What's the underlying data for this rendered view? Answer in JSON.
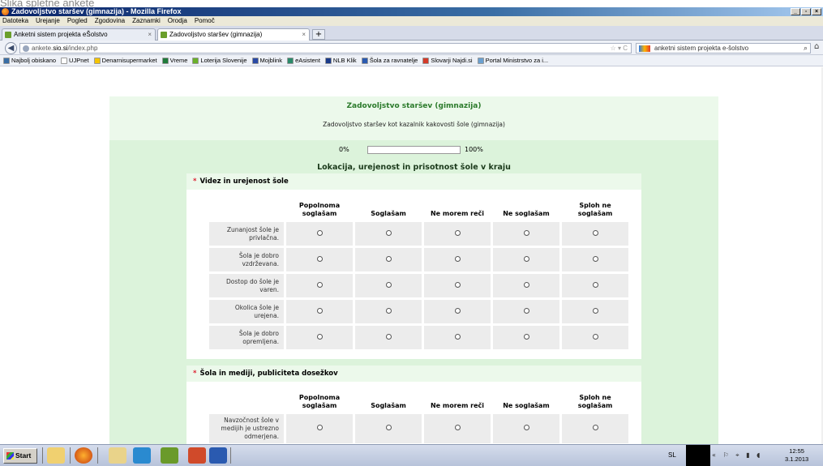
{
  "caption": "Slika spletne ankete",
  "window": {
    "title": "Zadovoljstvo staršev (gimnazija) - Mozilla Firefox",
    "controls": [
      "_",
      "▫",
      "×"
    ]
  },
  "menu": [
    "Datoteka",
    "Urejanje",
    "Pogled",
    "Zgodovina",
    "Zaznamki",
    "Orodja",
    "Pomoč"
  ],
  "tabs": [
    {
      "label": "Anketni sistem projekta eŠolstvo",
      "close": "×"
    },
    {
      "label": "Zadovoljstvo staršev (gimnazija)",
      "close": "×"
    }
  ],
  "newtab": "+",
  "nav": {
    "back": "◀",
    "url_prefix": "ankete.",
    "url_domain": "sio.si",
    "url_suffix": "/index.php",
    "url_icons": "☆ ▾ C",
    "search_text": "anketni sistem projekta e-šolstvo",
    "search_glyph": "⌕",
    "home": "⌂"
  },
  "bookmarks": [
    {
      "label": "Najbolj obiskano",
      "color": "#3a6ea5"
    },
    {
      "label": "UJPnet",
      "color": "#ffffff"
    },
    {
      "label": "Denarnisupermarket",
      "color": "#f5c400"
    },
    {
      "label": "Vreme",
      "color": "#1f7a3a"
    },
    {
      "label": "Loterija Slovenije",
      "color": "#6ab02a"
    },
    {
      "label": "Mojblink",
      "color": "#2a4aa5"
    },
    {
      "label": "eAsistent",
      "color": "#2a8a6a"
    },
    {
      "label": "NLB Klik",
      "color": "#1a3a8a"
    },
    {
      "label": "Šola za ravnatelje",
      "color": "#2a5ab0"
    },
    {
      "label": "Slovarji Najdi.si",
      "color": "#d33a2a"
    },
    {
      "label": "Portal Ministrstvo za i...",
      "color": "#6aa0d0"
    }
  ],
  "survey": {
    "title": "Zadovoljstvo staršev (gimnazija)",
    "subtitle": "Zadovoljstvo staršev kot kazalnik kakovosti šole (gimnazija)",
    "progress_left": "0%",
    "progress_right": "100%",
    "progress_fraction": 0,
    "section": "Lokacija, urejenost in prisotnost šole v kraju",
    "columns": [
      "Popolnoma soglašam",
      "Soglašam",
      "Ne morem reči",
      "Ne soglašam",
      "Sploh ne soglašam"
    ],
    "questions": [
      {
        "required": "*",
        "title": "Videz in urejenost šole",
        "rows": [
          "Zunanjost šole je privlačna.",
          "Šola je dobro vzdrževana.",
          "Dostop do šole je varen.",
          "Okolica šole je urejena.",
          "Šola je dobro opremljena."
        ]
      },
      {
        "required": "*",
        "title": "Šola in mediji, publiciteta dosežkov",
        "rows": [
          "Navzočnost šole v medijih je ustrezno odmerjena."
        ]
      }
    ]
  },
  "taskbar": {
    "start": "Start",
    "lang": "SL",
    "tray": "« ⚐ ⌖ ▮ ◖",
    "time": "12:55",
    "date": "3.1.2013"
  },
  "colors": {
    "survey_bg": "#dcf3db",
    "title_green": "#2a7a2a",
    "required_red": "#dd2233",
    "cell_gray": "#ececec"
  }
}
